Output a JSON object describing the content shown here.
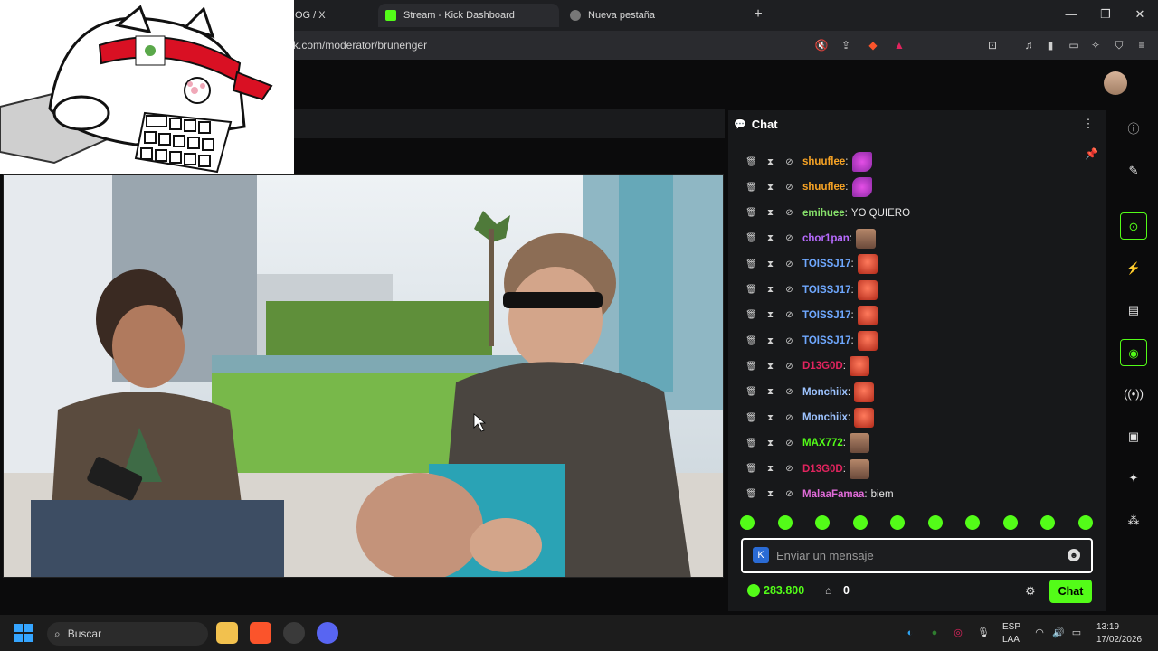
{
  "browser": {
    "tabs": [
      {
        "label": "OG / X"
      },
      {
        "label": "Stream - Kick Dashboard"
      },
      {
        "label": "Nueva pestaña"
      }
    ],
    "url": "ck.com/moderator/brunenger",
    "new_tab": "+"
  },
  "chat": {
    "title": "Chat",
    "messages": [
      {
        "user": "shuuflee",
        "color": "#f7a325",
        "text": "",
        "emote": "pink"
      },
      {
        "user": "shuuflee",
        "color": "#f7a325",
        "text": "",
        "emote": "pink"
      },
      {
        "user": "emihuee",
        "color": "#86e06a",
        "text": "YO QUIERO",
        "emote": ""
      },
      {
        "user": "chor1pan",
        "color": "#b86bff",
        "text": "",
        "emote": "brown"
      },
      {
        "user": "TOISSJ17",
        "color": "#6fa8ff",
        "text": "",
        "emote": "red"
      },
      {
        "user": "TOISSJ17",
        "color": "#6fa8ff",
        "text": "",
        "emote": "red"
      },
      {
        "user": "TOISSJ17",
        "color": "#6fa8ff",
        "text": "",
        "emote": "red"
      },
      {
        "user": "TOISSJ17",
        "color": "#6fa8ff",
        "text": "",
        "emote": "red"
      },
      {
        "user": "D13G0D",
        "color": "#e0245e",
        "text": "",
        "emote": "red"
      },
      {
        "user": "Monchiix",
        "color": "#9dc3ff",
        "text": "",
        "emote": "red"
      },
      {
        "user": "Monchiix",
        "color": "#9dc3ff",
        "text": "",
        "emote": "red"
      },
      {
        "user": "MAX772",
        "color": "#53fc18",
        "text": "",
        "emote": "brown"
      },
      {
        "user": "D13G0D",
        "color": "#e0245e",
        "text": "",
        "emote": "brown"
      },
      {
        "user": "MalaaFamaa",
        "color": "#e06bd8",
        "text": "biem",
        "emote": ""
      }
    ],
    "input_placeholder": "Enviar un mensaje",
    "points": "283.800",
    "store_count": "0",
    "send_label": "Chat"
  },
  "taskbar": {
    "search_label": "Buscar",
    "lang_top": "ESP",
    "lang_bottom": "LAA",
    "time": "13:19",
    "date": "17/02/2026"
  },
  "colors": {
    "accent": "#53fc18",
    "panel": "#17181a"
  }
}
